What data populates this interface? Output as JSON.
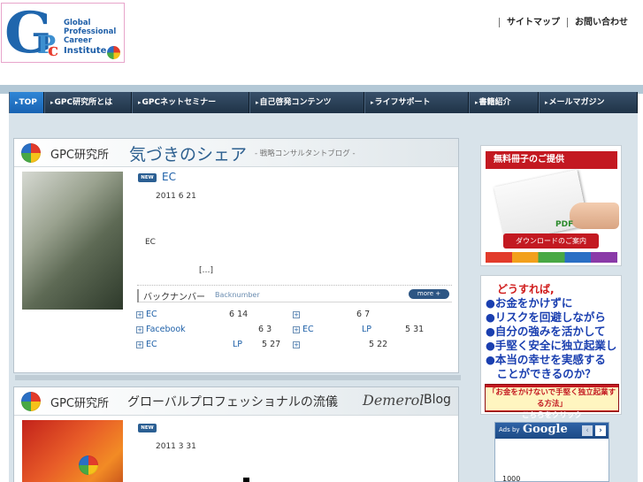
{
  "header": {
    "logo": {
      "letter_g": "G",
      "letter_p": "P",
      "letter_c": "c",
      "lines": [
        "Global",
        "Professional",
        "Career"
      ],
      "institute": "Institute"
    },
    "top_links": [
      "サイトマップ",
      "お問い合わせ"
    ]
  },
  "nav": {
    "items": [
      "TOP",
      "GPC研究所とは",
      "GPCネットセミナー",
      "自己啓発コンテンツ",
      "ライフサポート",
      "書籍紹介",
      "メールマガジン"
    ],
    "active_index": 0
  },
  "blog1": {
    "label": "GPC研究所",
    "title": "気づきのシェア",
    "subtitle": "- 戦略コンサルタントブログ -",
    "post": {
      "badge": "NEW",
      "title": "EC",
      "date": "2011  6  21",
      "body": "EC",
      "more": "[…]"
    },
    "backnumber": {
      "label": "バックナンバー",
      "label_en": "Backnumber",
      "more": "more +",
      "items": [
        {
          "left": "EC",
          "left_date": "6 14",
          "right": "",
          "right_date": "6 7"
        },
        {
          "left": "Facebook",
          "left_date": "6 3",
          "right": "EC",
          "right_mid": "LP",
          "right_date": "5 31"
        },
        {
          "left": "EC",
          "left_mid": "LP",
          "left_date": "5 27",
          "right": "",
          "right_date": "5 22"
        }
      ]
    }
  },
  "blog2": {
    "label": "GPC研究所",
    "title": "グローバルプロフェッショナルの流儀",
    "demerol": "Demerol",
    "blog": "Blog",
    "post": {
      "badge": "NEW",
      "date": "2011  3  31"
    }
  },
  "sidebar": {
    "booklet": {
      "heading": "無料冊子のご提供",
      "pdf": "PDF",
      "button": "ダウンロードのご案内"
    },
    "promo": {
      "question": "どうすれば,",
      "lines": [
        "●お金をかけずに",
        "●リスクを回避しながら",
        "●自分の強みを活かして",
        "●手堅く安全に独立起業し",
        "●本当の幸せを実感する",
        "　ことができるのか？"
      ],
      "banner_line1": "「お金をかけないで手堅く独立起業する方法」",
      "banner_line2": "こちらをクリック"
    },
    "ads": {
      "ads_by": "Ads by",
      "google": "Google",
      "prev": "‹",
      "next": "›",
      "text": "1000"
    }
  },
  "colors": {
    "nav_bg": "#1f3347",
    "nav_active": "#1863b3",
    "accent_red": "#c31921",
    "link_blue": "#1e60a8",
    "main_bg": "#d8e3ea"
  }
}
